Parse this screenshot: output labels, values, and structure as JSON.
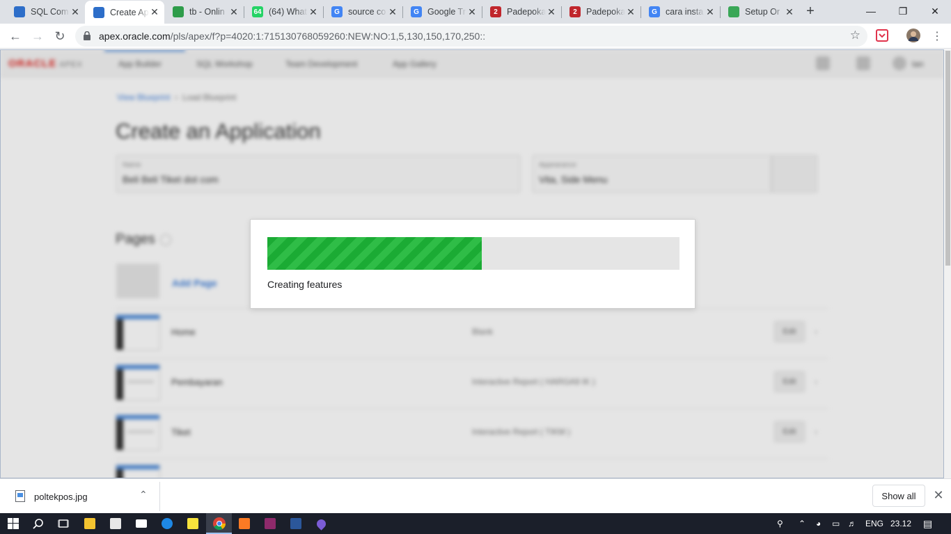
{
  "browser": {
    "tabs": [
      {
        "title": "SQL Com",
        "favicon": "apex-icon",
        "color": "#2d6ec9",
        "glyph": "",
        "active": false
      },
      {
        "title": "Create Ap",
        "favicon": "apex-icon",
        "color": "#2d6ec9",
        "glyph": "",
        "active": true
      },
      {
        "title": "tb - Onlin",
        "favicon": "leaf-icon",
        "color": "#2e9c4a",
        "glyph": "",
        "active": false
      },
      {
        "title": "(64) What",
        "favicon": "whatsapp-icon",
        "color": "#25d366",
        "glyph": "64",
        "active": false
      },
      {
        "title": "source co",
        "favicon": "google-icon",
        "color": "#4285f4",
        "glyph": "G",
        "active": false
      },
      {
        "title": "Google Tr",
        "favicon": "google-translate-icon",
        "color": "#4285f4",
        "glyph": "G",
        "active": false
      },
      {
        "title": "Padepoka",
        "favicon": "padepokan-icon",
        "color": "#c0262c",
        "glyph": "2",
        "active": false
      },
      {
        "title": "Padepoka",
        "favicon": "padepokan-icon",
        "color": "#c0262c",
        "glyph": "2",
        "active": false
      },
      {
        "title": "cara insta",
        "favicon": "google-icon",
        "color": "#4285f4",
        "glyph": "G",
        "active": false
      },
      {
        "title": "Setup Or",
        "favicon": "globe-icon",
        "color": "#3aa757",
        "glyph": "",
        "active": false
      }
    ],
    "url_host": "apex.oracle.com",
    "url_path": "/pls/apex/f?p=4020:1:715130768059260:NEW:NO:1,5,130,150,170,250::"
  },
  "apex": {
    "logo": "ORACLE",
    "logo_sub": "APEX",
    "nav": [
      "App Builder",
      "SQL Workshop",
      "Team Development",
      "App Gallery"
    ],
    "user": "tan",
    "breadcrumb_link": "View Blueprint",
    "breadcrumb_current": "Load Blueprint",
    "page_title": "Create an Application",
    "name_label": "Name",
    "name_value": "Beli Beli Tiket dot com",
    "appearance_label": "Appearance",
    "appearance_value": "Vita, Side Menu",
    "pages_title": "Pages",
    "add_page": "Add Page",
    "pages": [
      {
        "name": "Home",
        "type": "Blank",
        "edit": "Edit"
      },
      {
        "name": "Pembayaran",
        "type": "Interactive Report ( HARGA9 IK )",
        "edit": "Edit"
      },
      {
        "name": "Tiket",
        "type": "Interactive Report ( TIKM )",
        "edit": "Edit"
      }
    ]
  },
  "dialog": {
    "progress": 0.52,
    "status": "Creating features"
  },
  "downloads": {
    "file": "poltekpos.jpg",
    "show_all": "Show all"
  },
  "taskbar": {
    "lang": "ENG",
    "time": "23.12"
  }
}
